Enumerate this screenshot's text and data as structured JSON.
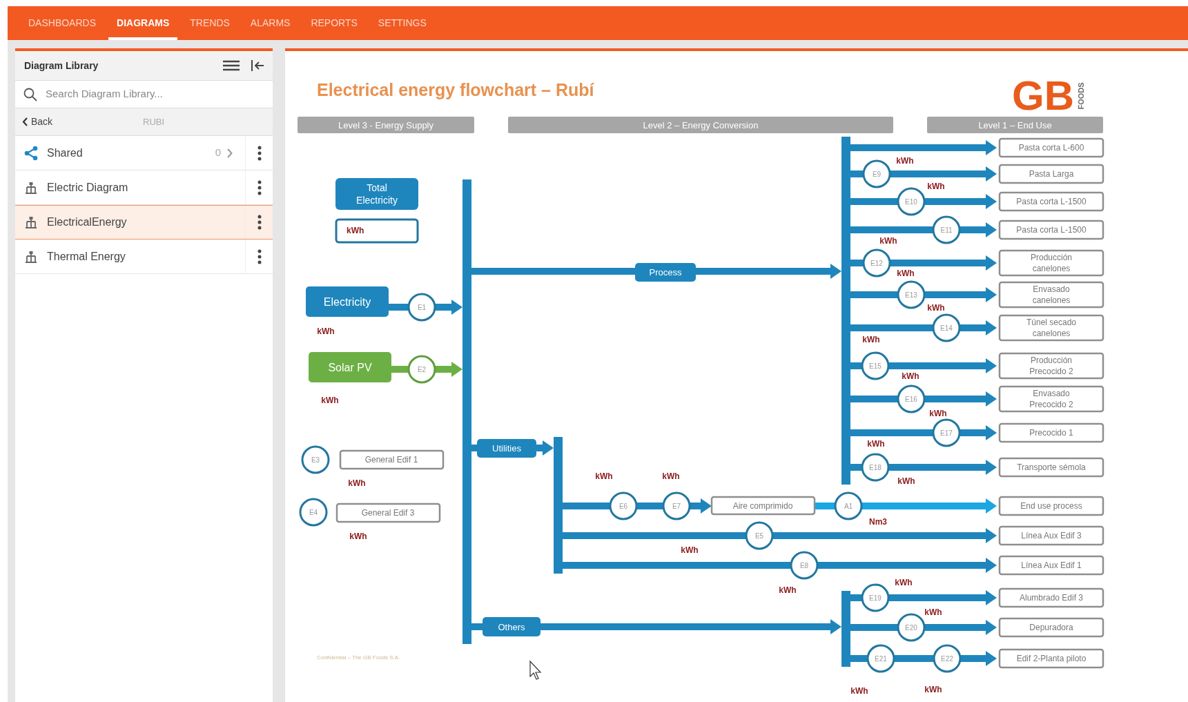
{
  "nav": [
    {
      "label": "DASHBOARDS",
      "selected": false
    },
    {
      "label": "DIAGRAMS",
      "selected": true
    },
    {
      "label": "TRENDS",
      "selected": false
    },
    {
      "label": "ALARMS",
      "selected": false
    },
    {
      "label": "REPORTS",
      "selected": false
    },
    {
      "label": "SETTINGS",
      "selected": false
    }
  ],
  "sidebar": {
    "title": "Diagram Library",
    "search": {
      "placeholder": "Search Diagram Library..."
    },
    "back": "Back",
    "folder": "RUBI",
    "items": [
      {
        "kind": "shared",
        "label": "Shared",
        "count": "0",
        "selected": false
      },
      {
        "kind": "diagram",
        "label": "Electric Diagram",
        "selected": false
      },
      {
        "kind": "diagram",
        "label": "ElectricalEnergy",
        "selected": true
      },
      {
        "kind": "diagram",
        "label": "Thermal Energy",
        "selected": false
      }
    ]
  },
  "diagram": {
    "title": "Electrical energy flowchart – Rubí",
    "logo": {
      "letters": "GB",
      "sub": "FOODS"
    },
    "levels": [
      "Level 3 - Energy Supply",
      "Level 2 – Energy Conversion",
      "Level 1 – End Use"
    ],
    "total": {
      "label_lines": [
        "Total",
        "Electricity"
      ],
      "unit": "kWh"
    },
    "supplies": [
      {
        "kind": "grid",
        "label": "Electricity",
        "meter": "E1",
        "unit": "kWh"
      },
      {
        "kind": "solar",
        "label": "Solar PV",
        "meter": "E2",
        "unit": "kWh"
      }
    ],
    "buildings": [
      {
        "meter": "E3",
        "label": "General Edif 1",
        "unit": "kWh"
      },
      {
        "meter": "E4",
        "label": "General Edif 3",
        "unit": "kWh"
      }
    ],
    "trunks": [
      "Process",
      "Utilities",
      "Others"
    ],
    "process_branches": [
      {
        "end": [
          "Pasta corta L-600"
        ]
      },
      {
        "meters": [
          {
            "id": "E9",
            "unit": "kWh"
          }
        ],
        "end": [
          "Pasta Larga"
        ]
      },
      {
        "meters": [
          {
            "id": "E10",
            "unit": "kWh"
          }
        ],
        "end": [
          "Pasta corta L-1500"
        ]
      },
      {
        "meters": [
          {
            "id": "E11",
            "unit": "kWh"
          }
        ],
        "end": [
          "Pasta corta L-1500"
        ]
      },
      {
        "meters": [
          {
            "id": "E12",
            "unit": "kWh"
          }
        ],
        "end": [
          "Producción",
          "canelones"
        ]
      },
      {
        "meters": [
          {
            "id": "E13",
            "unit": "kWh"
          }
        ],
        "end": [
          "Envasado",
          "canelones"
        ]
      },
      {
        "meters": [
          {
            "id": "E14",
            "unit": "kWh"
          }
        ],
        "end": [
          "Túnel secado",
          "canelones"
        ]
      },
      {
        "meters": [
          {
            "id": "E15",
            "unit": "kWh"
          }
        ],
        "end": [
          "Producción",
          "Precocido 2"
        ]
      },
      {
        "meters": [
          {
            "id": "E16",
            "unit": "kWh"
          }
        ],
        "end": [
          "Envasado",
          "Precocido 2"
        ]
      },
      {
        "meters": [
          {
            "id": "E17",
            "unit": "kWh"
          }
        ],
        "end": [
          "Precocido 1"
        ]
      },
      {
        "meters": [
          {
            "id": "E18",
            "unit": "kWh"
          }
        ],
        "end": [
          "Transporte sémola"
        ]
      }
    ],
    "utility_branches": [
      {
        "meters": [
          {
            "id": "E6",
            "unit": "kWh"
          },
          {
            "id": "E7",
            "unit": "kWh"
          }
        ],
        "via": "Aire comprimido",
        "via_meters": [
          {
            "id": "A1",
            "unit": "Nm3"
          }
        ],
        "end": [
          "End use process"
        ]
      },
      {
        "meters": [
          {
            "id": "E5",
            "unit": "kWh"
          }
        ],
        "end": [
          "Línea Aux Edif 3"
        ]
      },
      {
        "meters": [
          {
            "id": "E8",
            "unit": "kWh"
          }
        ],
        "end": [
          "Línea Aux Edif 1"
        ]
      }
    ],
    "other_branches": [
      {
        "meters": [
          {
            "id": "E19",
            "unit": "kWh"
          }
        ],
        "end": [
          "Alumbrado Edif 3"
        ]
      },
      {
        "meters": [
          {
            "id": "E20",
            "unit": "kWh"
          }
        ],
        "end": [
          "Depuradora"
        ]
      },
      {
        "meters": [
          {
            "id": "E21",
            "unit": "kWh"
          },
          {
            "id": "E22",
            "unit": "kWh"
          }
        ],
        "end": [
          "Edif 2-Planta piloto"
        ]
      }
    ],
    "footer": "Confidential – The GB Foods S.A."
  }
}
